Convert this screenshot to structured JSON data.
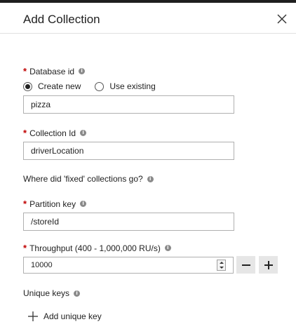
{
  "header": {
    "title": "Add Collection"
  },
  "database": {
    "label": "Database id",
    "required": "*",
    "radio_create_new": "Create new",
    "radio_use_existing": "Use existing",
    "selected": "Create new",
    "value": "pizza"
  },
  "collection": {
    "label": "Collection Id",
    "required": "*",
    "value": "driverLocation"
  },
  "fixed_collections": {
    "label": "Where did 'fixed' collections go?"
  },
  "partition": {
    "label": "Partition key",
    "required": "*",
    "value": "/storeId"
  },
  "throughput": {
    "label": "Throughput (400 - 1,000,000 RU/s)",
    "required": "*",
    "value": "10000"
  },
  "unique_keys": {
    "label": "Unique keys",
    "add_label": "Add unique key"
  },
  "icons": {
    "close": "close-icon",
    "info": "info-icon",
    "minus": "minus-icon",
    "plus": "plus-icon",
    "add": "add-icon"
  },
  "colors": {
    "required": "#c00000",
    "step_button_bg": "#e6e6e6",
    "topbar": "#1f1f1f"
  }
}
